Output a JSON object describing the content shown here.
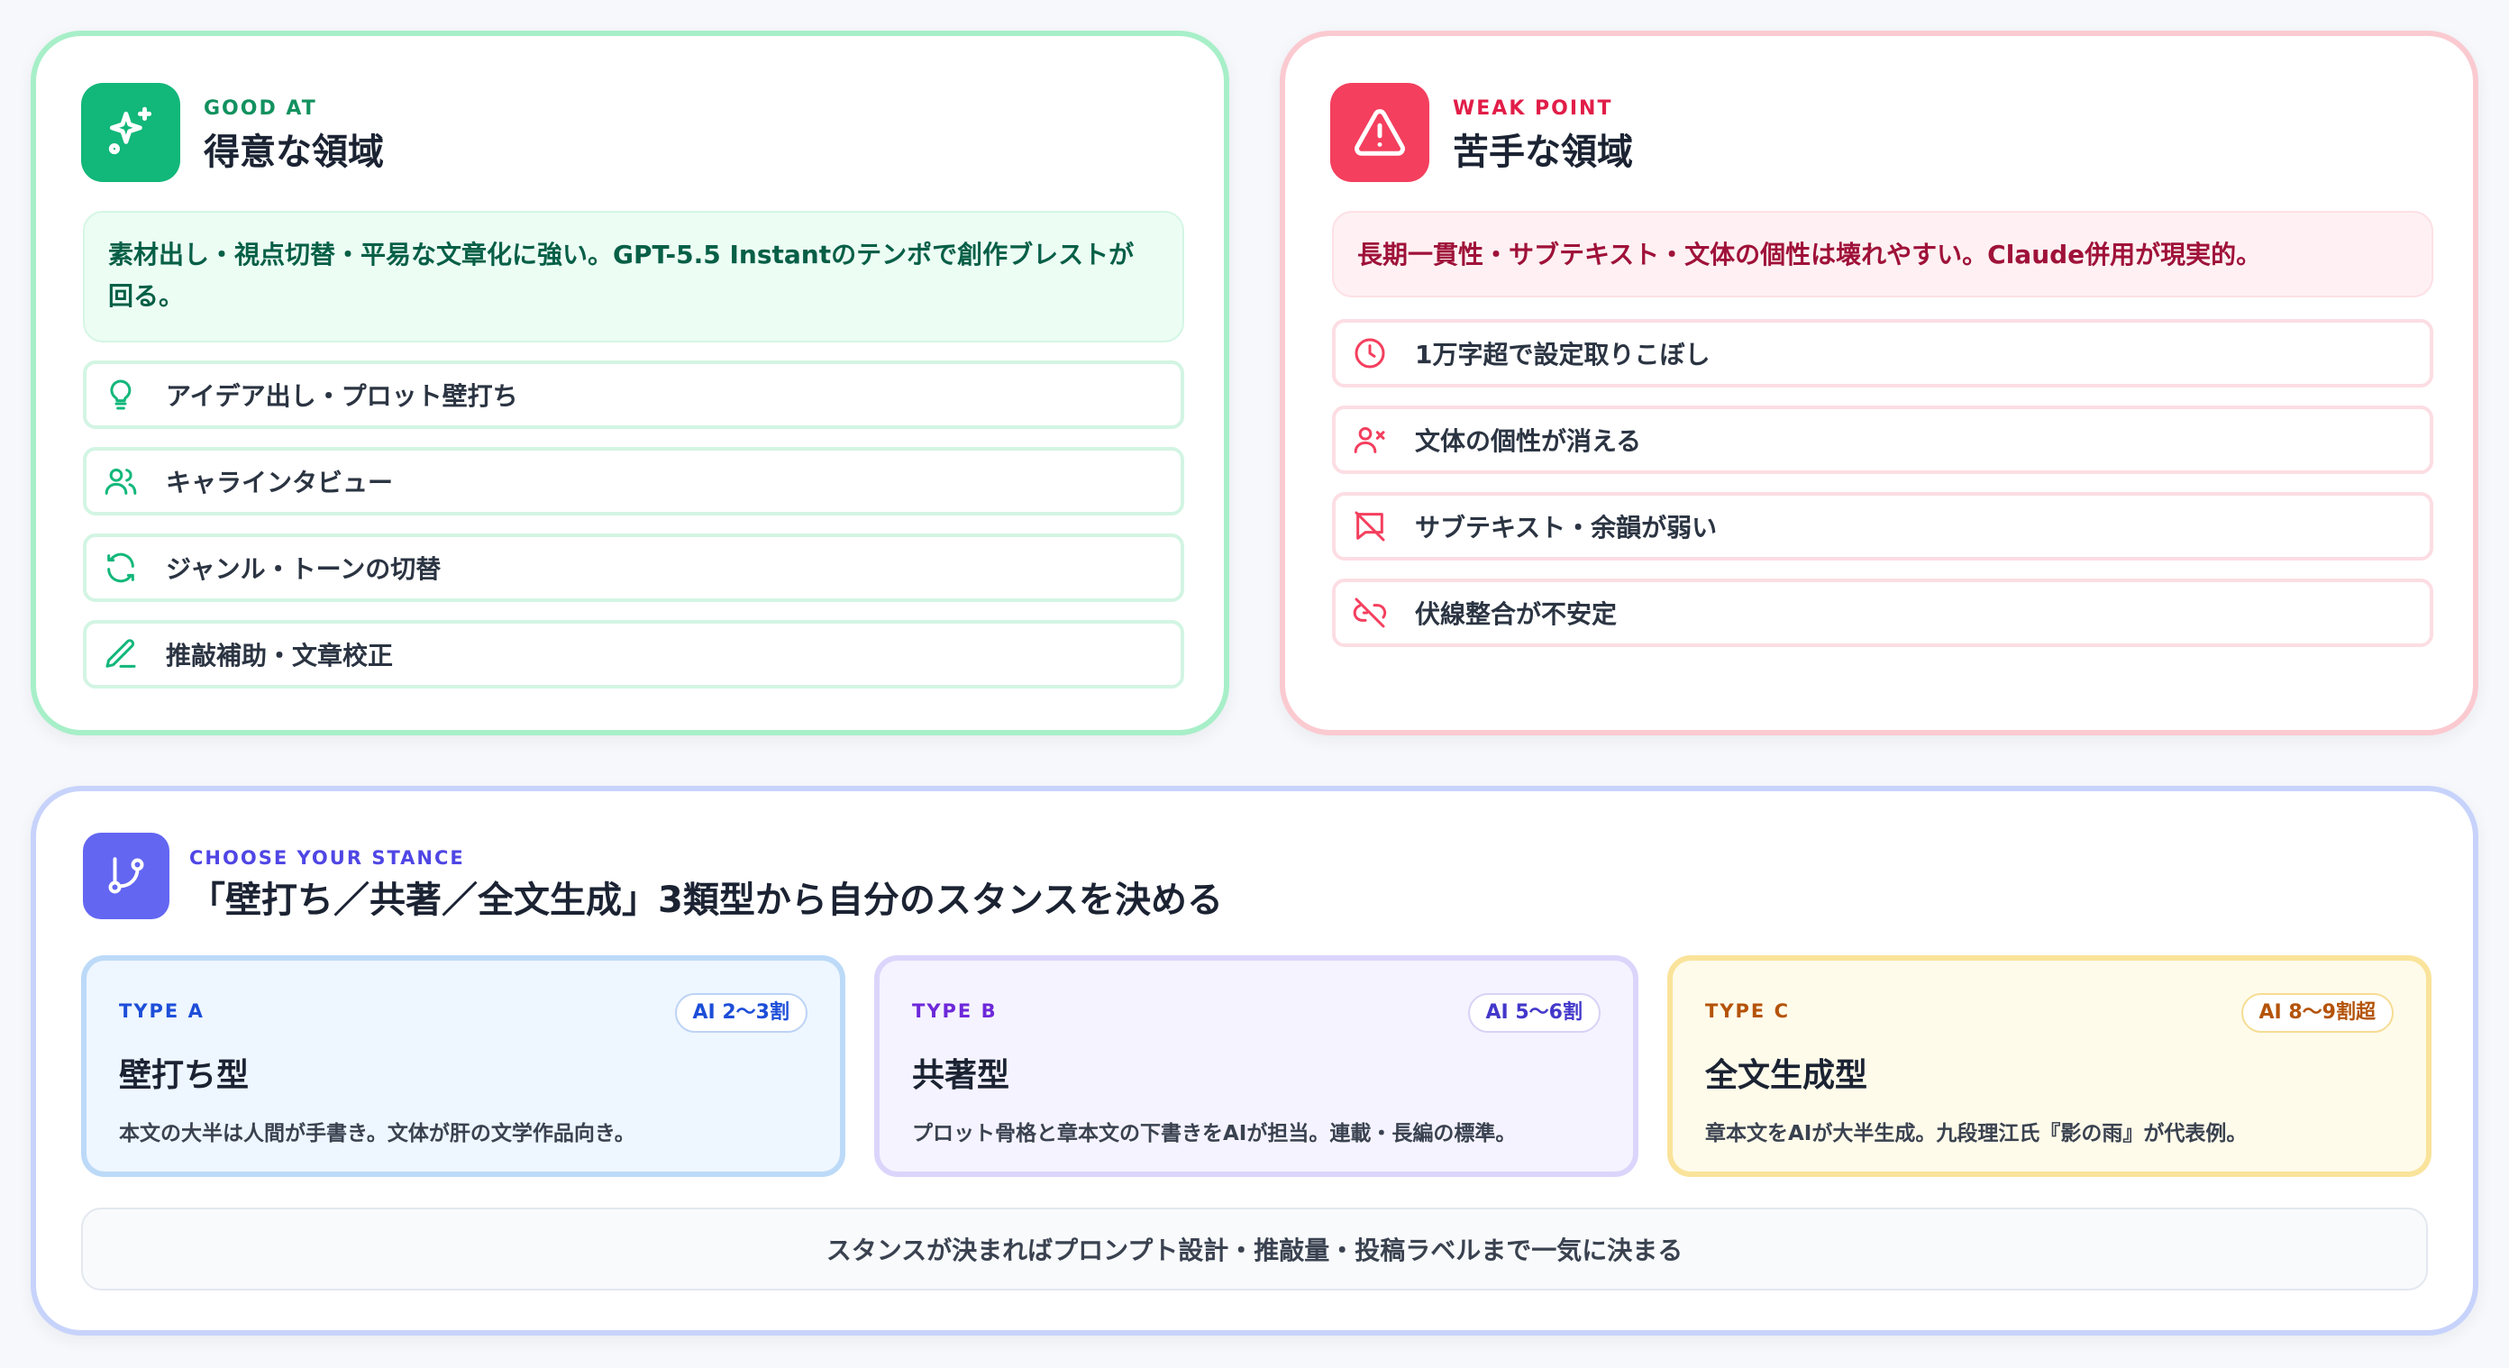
{
  "good": {
    "eyebrow": "GOOD AT",
    "title": "得意な領域",
    "summary": "素材出し・視点切替・平易な文章化に強い。GPT-5.5 Instantのテンポで創作ブレストが回る。",
    "items": [
      {
        "label": "アイデア出し・プロット壁打ち",
        "icon": "lightbulb-icon"
      },
      {
        "label": "キャラインタビュー",
        "icon": "users-icon"
      },
      {
        "label": "ジャンル・トーンの切替",
        "icon": "refresh-icon"
      },
      {
        "label": "推敲補助・文章校正",
        "icon": "pen-icon"
      }
    ],
    "colors": {
      "accent": "#12b77a",
      "border": "#a7efc8",
      "summary_bg": "#ecfdf4",
      "text": "#065f46"
    }
  },
  "weak": {
    "eyebrow": "WEAK POINT",
    "title": "苦手な領域",
    "summary": "長期一貫性・サブテキスト・文体の個性は壊れやすい。Claude併用が現実的。",
    "items": [
      {
        "label": "1万字超で設定取りこぼし",
        "icon": "clock-icon"
      },
      {
        "label": "文体の個性が消える",
        "icon": "user-x-icon"
      },
      {
        "label": "サブテキスト・余韻が弱い",
        "icon": "message-off-icon"
      },
      {
        "label": "伏線整合が不安定",
        "icon": "link-off-icon"
      }
    ],
    "colors": {
      "accent": "#f43f5e",
      "border": "#fbcad1",
      "summary_bg": "#fff1f3",
      "text": "#9f1239"
    }
  },
  "stance": {
    "eyebrow": "CHOOSE YOUR STANCE",
    "title": "「壁打ち／共著／全文生成」3類型から自分のスタンスを決める",
    "types": [
      {
        "tag": "TYPE A",
        "ratio": "AI 2〜3割",
        "title": "壁打ち型",
        "desc": "本文の大半は人間が手書き。文体が肝の文学作品向き。"
      },
      {
        "tag": "TYPE B",
        "ratio": "AI 5〜6割",
        "title": "共著型",
        "desc": "プロット骨格と章本文の下書きをAIが担当。連載・長編の標準。"
      },
      {
        "tag": "TYPE C",
        "ratio": "AI 8〜9割超",
        "title": "全文生成型",
        "desc": "章本文をAIが大半生成。九段理江氏『影の雨』が代表例。"
      }
    ],
    "footer": "スタンスが決まればプロンプト設計・推敲量・投稿ラベルまで一気に決まる",
    "colors": {
      "accent": "#6366f1",
      "border": "#c7d3fb"
    }
  }
}
